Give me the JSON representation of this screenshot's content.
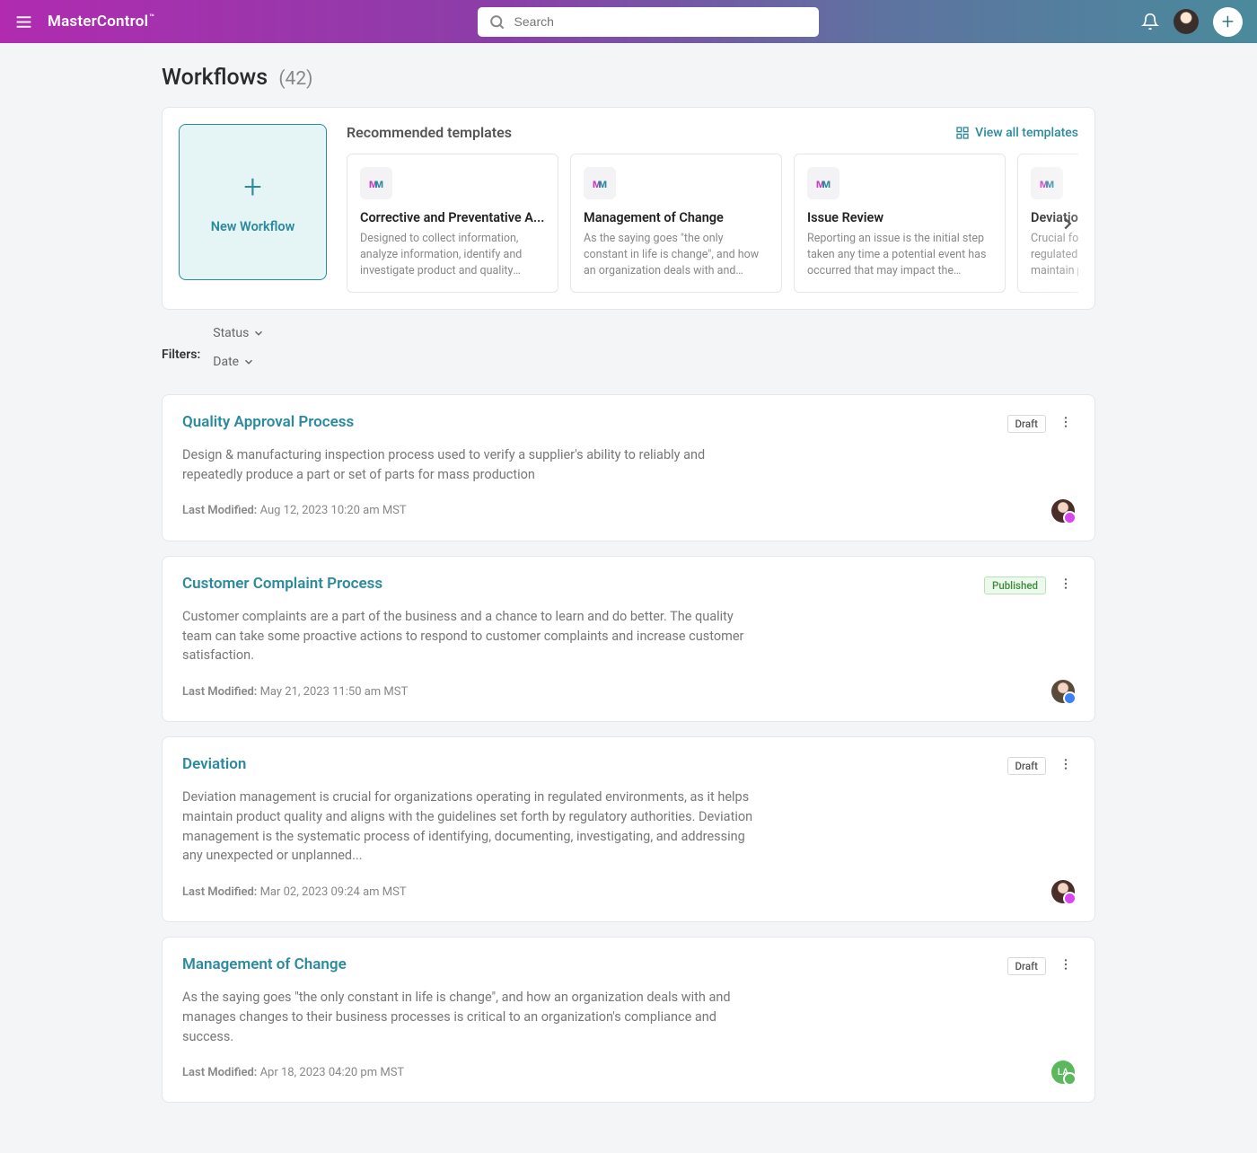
{
  "header": {
    "brand": "MasterControl",
    "search_placeholder": "Search"
  },
  "page": {
    "title": "Workflows",
    "count_display": "(42)"
  },
  "recommended": {
    "heading": "Recommended templates",
    "view_all_label": "View all templates",
    "new_workflow_label": "New Workflow",
    "templates": [
      {
        "title": "Corrective and Preventative A...",
        "desc": "Designed to collect information, analyze information, identify and investigate product and quality prob..."
      },
      {
        "title": "Management of Change",
        "desc": "As the saying goes \"the only constant in life is change\", and how an organization deals with and manage..."
      },
      {
        "title": "Issue Review",
        "desc": "Reporting an issue is the initial step taken any time a potential event has occurred that may impact the qualit..."
      },
      {
        "title": "Deviation Management",
        "desc": "Crucial for organizations operating in regulated environments, as it helps maintain product quality."
      }
    ]
  },
  "filters": {
    "label": "Filters:",
    "items": [
      "Status",
      "Date"
    ]
  },
  "workflows": [
    {
      "title": "Quality Approval Process",
      "status": "Draft",
      "status_class": "draft",
      "desc": "Design & manufacturing inspection process used to verify a supplier's ability to reliably and repeatedly produce a part or set of parts for mass production",
      "modified_prefix": "Last Modified:",
      "modified_value": "Aug 12, 2023 10:20 am MST",
      "avatar_class": "av-pink",
      "avatar_text": ""
    },
    {
      "title": "Customer Complaint Process",
      "status": "Published",
      "status_class": "published",
      "desc": "Customer complaints are a part of the business and a chance to learn and do better. The quality team can take some proactive actions to respond to customer complaints and increase customer satisfaction.",
      "modified_prefix": "Last Modified:",
      "modified_value": "May 21, 2023 11:50 am MST",
      "avatar_class": "av-blue",
      "avatar_text": ""
    },
    {
      "title": "Deviation",
      "status": "Draft",
      "status_class": "draft",
      "desc": "Deviation management is crucial for organizations operating in regulated environments, as it helps maintain product quality and aligns with the guidelines set forth by regulatory authorities. Deviation management is the systematic process of identifying, documenting, investigating, and addressing any unexpected or unplanned...",
      "modified_prefix": "Last Modified:",
      "modified_value": "Mar 02, 2023 09:24 am MST",
      "avatar_class": "av-pink",
      "avatar_text": ""
    },
    {
      "title": "Management of Change",
      "status": "Draft",
      "status_class": "draft",
      "desc": "As the saying goes \"the only constant in life is change\", and how an organization deals with and manages changes to their business processes is critical to an organization's compliance and success.",
      "modified_prefix": "Last Modified:",
      "modified_value": "Apr 18, 2023 04:20 pm MST",
      "avatar_class": "av-green",
      "avatar_text": "LA"
    }
  ]
}
